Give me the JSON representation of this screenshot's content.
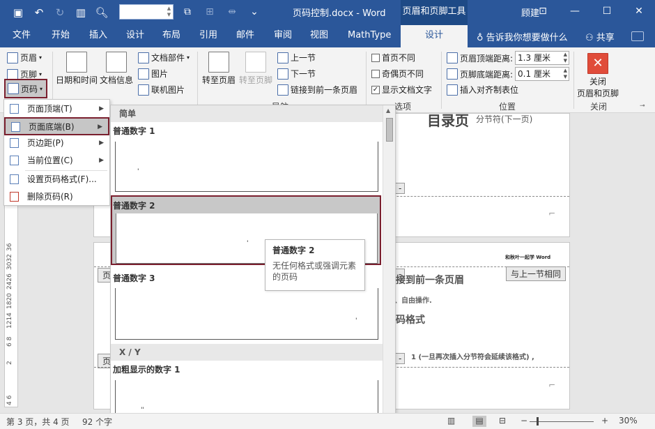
{
  "title_bar": {
    "doc_title": "页码控制.docx  -  Word",
    "contextual_label": "页眉和页脚工具",
    "user_name": "顾建",
    "font_size_value": ""
  },
  "tabs": [
    {
      "label": "文件"
    },
    {
      "label": "开始"
    },
    {
      "label": "插入"
    },
    {
      "label": "设计"
    },
    {
      "label": "布局"
    },
    {
      "label": "引用"
    },
    {
      "label": "邮件"
    },
    {
      "label": "审阅"
    },
    {
      "label": "视图"
    },
    {
      "label": "MathType"
    },
    {
      "label": "设计"
    }
  ],
  "tell_me": "告诉我你想要做什么",
  "share": "共享",
  "ribbon": {
    "header": "页眉",
    "footer": "页脚",
    "page_number": "页码",
    "date_time": "日期和时间",
    "doc_info": "文档信息",
    "doc_parts": "文档部件",
    "picture": "图片",
    "online_picture": "联机图片",
    "goto_header": "转至页眉",
    "goto_footer": "转至页脚",
    "prev_section": "上一节",
    "next_section": "下一节",
    "link_prev": "链接到前一条页眉",
    "nav_label": "导航",
    "diff_first": "首页不同",
    "diff_odd_even": "奇偶页不同",
    "show_doc_text": "显示文档文字",
    "options_label": "选项",
    "header_from_top_label": "页眉顶端距离:",
    "header_from_top_value": "1.3 厘米",
    "footer_from_bottom_label": "页脚底端距离:",
    "footer_from_bottom_value": "0.1 厘米",
    "insert_align_tab": "插入对齐制表位",
    "position_label": "位置",
    "close_label": "关闭\n页眉和页脚",
    "close_group_label": "关闭"
  },
  "menu": {
    "items": [
      {
        "label": "页面顶端(T)"
      },
      {
        "label": "页面底端(B)"
      },
      {
        "label": "页边距(P)"
      },
      {
        "label": "当前位置(C)"
      },
      {
        "label": "设置页码格式(F)..."
      },
      {
        "label": "删除页码(R)"
      }
    ]
  },
  "gallery": {
    "section_simple": "简单",
    "item1": "普通数字 1",
    "item2": "普通数字 2",
    "item3": "普通数字 3",
    "section_xy": "X / Y",
    "item4": "加粗显示的数字 1"
  },
  "tooltip": {
    "title": "普通数字 2",
    "desc": "无任何格式或强调元素的页码"
  },
  "document": {
    "page1_heading": "目录页",
    "page1_break": "分节符(下一页)",
    "page2_header_right": "和秋叶一起学 Word",
    "same_as_prev": "与上一节相同",
    "header_tag": "页",
    "footer_tag": "页",
    "line1": "接到前一条页眉",
    "line2": "、自由操作.",
    "line3": "码格式",
    "line4": "1 (一旦再次插入分节符会延续该格式) ,"
  },
  "ruler_marks": [
    "4 6",
    "2",
    "6 8",
    "1214",
    "1820",
    "2426",
    "3032",
    "36"
  ],
  "status": {
    "page": "第 3 页，共 4 页",
    "words": "92 个字",
    "zoom": "30%"
  }
}
